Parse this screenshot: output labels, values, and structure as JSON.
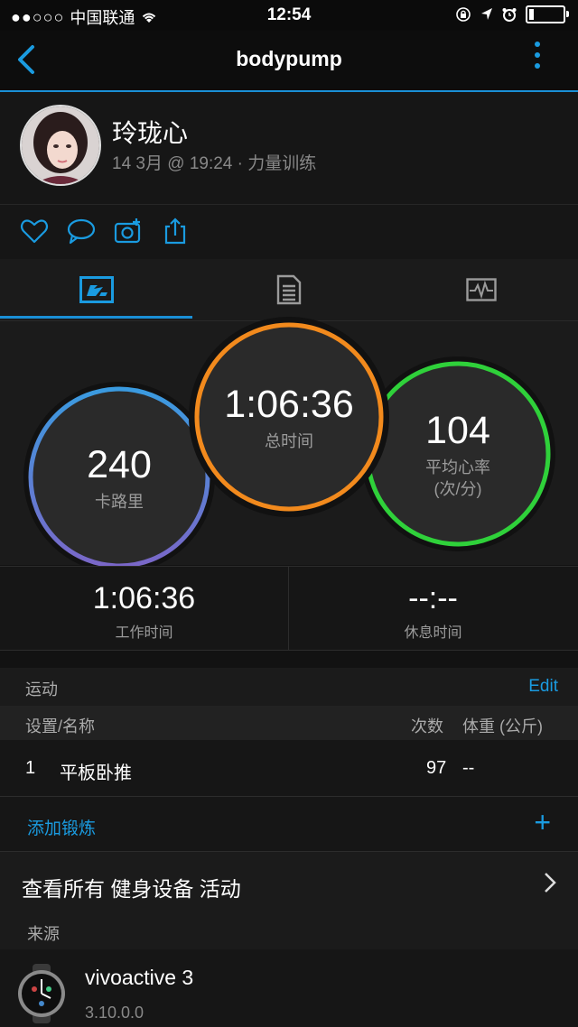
{
  "status": {
    "carrier": "中国联通",
    "time": "12:54"
  },
  "nav": {
    "title": "bodypump"
  },
  "profile": {
    "name": "玲珑心",
    "meta": "14 3月 @ 19:24 · 力量训练"
  },
  "stats": {
    "calories": {
      "value": "240",
      "label": "卡路里"
    },
    "total_time": {
      "value": "1:06:36",
      "label": "总时间"
    },
    "avg_hr": {
      "value": "104",
      "label": "平均心率",
      "unit": "(次/分)"
    }
  },
  "work_rest": {
    "work": {
      "value": "1:06:36",
      "label": "工作时间"
    },
    "rest": {
      "value": "--:--",
      "label": "休息时间"
    }
  },
  "exercises": {
    "section_title": "运动",
    "edit_label": "Edit",
    "columns": {
      "name": "设置/名称",
      "reps": "次数",
      "weight": "体重 (公斤)"
    },
    "rows": [
      {
        "index": "1",
        "name": "平板卧推",
        "reps": "97",
        "weight": "--"
      }
    ],
    "add_label": "添加锻炼",
    "add_icon": "+"
  },
  "view_all": {
    "label": "查看所有 健身设备 活动"
  },
  "source": {
    "section_title": "来源",
    "device_name": "vivoactive 3",
    "device_version": "3.10.0.0"
  },
  "colors": {
    "accent": "#1a8fd6",
    "calories_ring_top": "#3a9be0",
    "calories_ring_bottom": "#7a67c8",
    "time_ring": "#f28a1d",
    "hr_ring": "#2fd13a"
  }
}
